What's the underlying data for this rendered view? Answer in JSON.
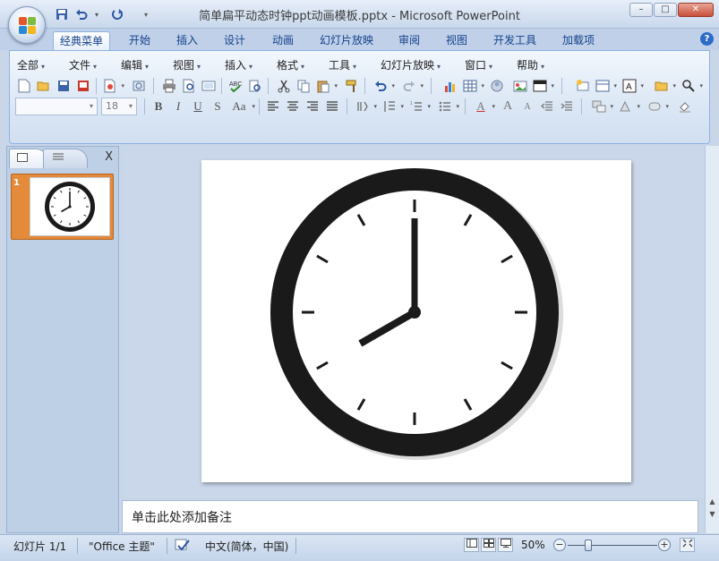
{
  "window": {
    "title": "简单扁平动态时钟ppt动画模板.pptx - Microsoft PowerPoint",
    "controls": {
      "minimize": "–",
      "maximize": "□",
      "close": "✕"
    }
  },
  "ribbon": {
    "tabs": [
      {
        "label": "经典菜单"
      },
      {
        "label": "开始"
      },
      {
        "label": "插入"
      },
      {
        "label": "设计"
      },
      {
        "label": "动画"
      },
      {
        "label": "幻灯片放映"
      },
      {
        "label": "审阅"
      },
      {
        "label": "视图"
      },
      {
        "label": "开发工具"
      },
      {
        "label": "加载项"
      }
    ],
    "help": "?",
    "menus": [
      {
        "label": "全部"
      },
      {
        "label": "文件"
      },
      {
        "label": "编辑"
      },
      {
        "label": "视图"
      },
      {
        "label": "插入"
      },
      {
        "label": "格式"
      },
      {
        "label": "工具"
      },
      {
        "label": "幻灯片放映"
      },
      {
        "label": "窗口"
      },
      {
        "label": "帮助"
      }
    ],
    "font_name_value": "",
    "font_size_value": "18",
    "format_buttons": {
      "bold": "B",
      "italic": "I",
      "underline": "U",
      "shadow": "S",
      "case": "Aa",
      "font_color": "A",
      "grow": "A",
      "shrink": "A"
    }
  },
  "slides_panel": {
    "close": "X",
    "thumbnails": [
      {
        "number": "1"
      }
    ]
  },
  "clock": {
    "hour": 8,
    "minute": 0,
    "ring_color": "#1a1a1a",
    "face_color": "#ffffff"
  },
  "notes": {
    "placeholder": "单击此处添加备注"
  },
  "statusbar": {
    "slide_counter": "幻灯片 1/1",
    "theme": "\"Office 主题\"",
    "language": "中文(简体，中国)",
    "zoom": "50%"
  },
  "colors": {
    "accent": "#15428b",
    "selected_thumbnail": "#e38a3b"
  }
}
